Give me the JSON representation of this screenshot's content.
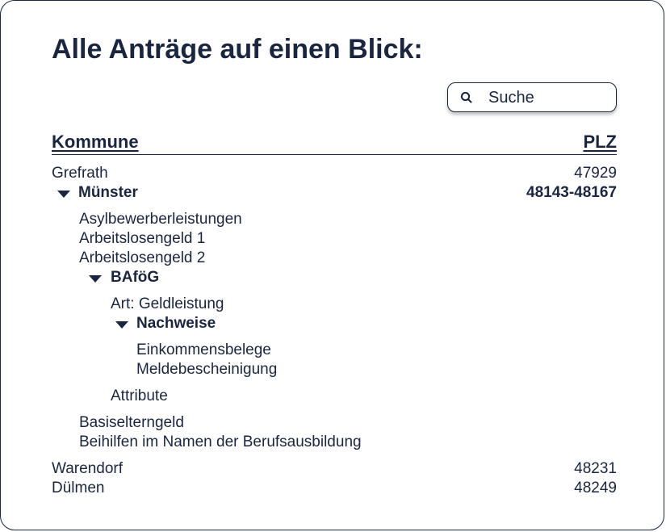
{
  "page": {
    "title": "Alle Anträge auf einen Blick:"
  },
  "search": {
    "placeholder": "Suche",
    "icon": "search-icon"
  },
  "table": {
    "columns": {
      "kommune": "Kommune",
      "plz": "PLZ"
    },
    "rows": [
      {
        "name": "Grefrath",
        "plz": "47929"
      },
      {
        "name": "Münster",
        "plz": "48143-48167",
        "expanded": true
      },
      {
        "name": "Warendorf",
        "plz": "48231"
      },
      {
        "name": "Dülmen",
        "plz": "48249"
      }
    ],
    "muenster_children": [
      "Asylbewerberleistungen",
      "Arbeitslosengeld 1",
      "Arbeitslosengeld 2",
      "BAföG",
      "Basiselterngeld",
      "Beihilfen im Namen der Berufsausbildung"
    ],
    "bafoeg_children": [
      "Art: Geldleistung",
      "Nachweise",
      "Attribute"
    ],
    "nachweise_children": [
      "Einkommensbelege",
      "Meldebescheinigung"
    ]
  },
  "colors": {
    "text": "#1a2540",
    "border": "#1a2540",
    "background": "#ffffff"
  }
}
